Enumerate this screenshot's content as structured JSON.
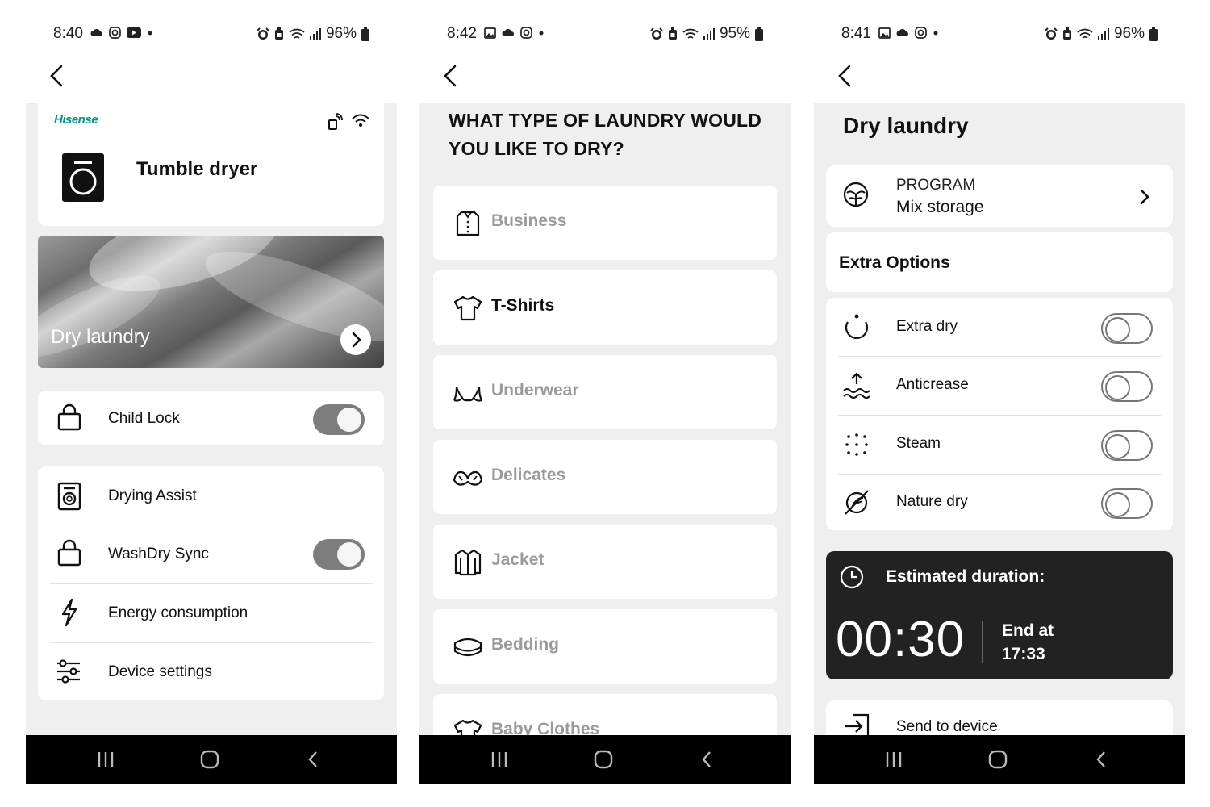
{
  "screens": [
    {
      "status": {
        "time": "8:40",
        "battery": "96%"
      },
      "brand": "Hisense",
      "device_title": "Tumble dryer",
      "hero_label": "Dry laundry",
      "child_lock_label": "Child Lock",
      "menu": [
        {
          "label": "Drying Assist",
          "icon": "dryer-icon"
        },
        {
          "label": "WashDry Sync",
          "icon": "lock-icon",
          "toggle": true
        },
        {
          "label": "Energy consumption",
          "icon": "bolt-icon"
        },
        {
          "label": "Device settings",
          "icon": "sliders-icon"
        }
      ]
    },
    {
      "status": {
        "time": "8:42",
        "battery": "95%"
      },
      "question": "WHAT TYPE OF LAUNDRY WOULD YOU LIKE TO DRY?",
      "laundry_types": [
        {
          "label": "Business",
          "icon": "shirt-icon",
          "selected": false
        },
        {
          "label": "T-Shirts",
          "icon": "tshirt-icon",
          "selected": true
        },
        {
          "label": "Underwear",
          "icon": "underwear-icon",
          "selected": false
        },
        {
          "label": "Delicates",
          "icon": "bra-icon",
          "selected": false
        },
        {
          "label": "Jacket",
          "icon": "jacket-icon",
          "selected": false
        },
        {
          "label": "Bedding",
          "icon": "bedding-icon",
          "selected": false
        },
        {
          "label": "Baby Clothes",
          "icon": "babyclothes-icon",
          "selected": false
        }
      ]
    },
    {
      "status": {
        "time": "8:41",
        "battery": "96%"
      },
      "title": "Dry laundry",
      "program_label": "PROGRAM",
      "program_value": "Mix storage",
      "extra_title": "Extra Options",
      "options": [
        {
          "label": "Extra dry",
          "icon": "extradry-icon",
          "on": false
        },
        {
          "label": "Anticrease",
          "icon": "anticrease-icon",
          "on": false
        },
        {
          "label": "Steam",
          "icon": "steam-icon",
          "on": false
        },
        {
          "label": "Nature dry",
          "icon": "naturedry-icon",
          "on": false
        }
      ],
      "estimated_label": "Estimated duration:",
      "duration": "00:30",
      "end_label": "End at",
      "end_time": "17:33",
      "send_label": "Send to device"
    }
  ],
  "colors": {
    "brand": "#0a8f86",
    "dark_panel": "#222222",
    "bg": "#efefef",
    "toggle_on": "#7d7d7d"
  }
}
